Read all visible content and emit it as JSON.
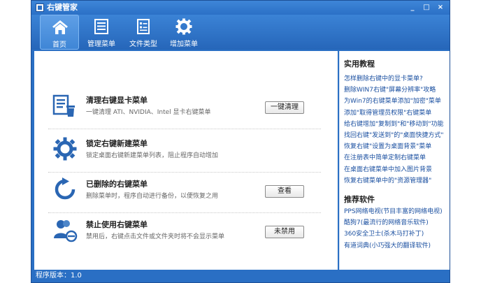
{
  "window": {
    "title": "右键管家",
    "controls": [
      "_",
      "□",
      "×"
    ]
  },
  "toolbar": {
    "items": [
      {
        "label": "首页",
        "icon": "home-icon",
        "active": true
      },
      {
        "label": "管理菜单",
        "icon": "menu-list-icon",
        "active": false
      },
      {
        "label": "文件类型",
        "icon": "file-type-icon",
        "active": false
      },
      {
        "label": "增加菜单",
        "icon": "gear-icon",
        "active": false
      }
    ]
  },
  "main": {
    "features": [
      {
        "title": "清理右键显卡菜单",
        "desc": "一键清理 ATI、NVIDIA、Intel 显卡右键菜单",
        "button": "一键清理",
        "icon": "cleanup-icon"
      },
      {
        "title": "锁定右键新建菜单",
        "desc": "锁定桌面右键新建菜单列表，阻止程序自动增加",
        "button": "",
        "icon": "gear-icon"
      },
      {
        "title": "已删除的右键菜单",
        "desc": "删除菜单时，程序自动进行备份，以便恢复之用",
        "button": "查看",
        "icon": "refresh-icon"
      },
      {
        "title": "禁止使用右键菜单",
        "desc": "禁用后，右键点击文件或文件夹时将不会显示菜单",
        "button": "未禁用",
        "icon": "user-disable-icon"
      }
    ]
  },
  "sidebar": {
    "tutorials_title": "实用教程",
    "tutorials": [
      "怎样删除右键中的显卡菜单?",
      "删除WIN7右键\"屏幕分辨率\"攻略",
      "为Win7的右键菜单添加\"加密\"菜单",
      "添加\"取得管理员权限\"右键菜单",
      "给右键增加\"复制到\"和\"移动到\"功能",
      "找回右键\"发送到\"的\"桌面快捷方式\"",
      "恢复右键\"设置为桌面背景\"菜单",
      "在注册表中简单定制右键菜单",
      "在桌面右键菜单中加入图片背景",
      "恢复右键菜单中的\"资源管理器\""
    ],
    "software_title": "推荐软件",
    "software": [
      "PPS网络电视(节目丰富的网络电视)",
      "酷狗7(最流行的网络音乐软件)",
      "360安全卫士(杀木马打补丁)",
      "有道词典(小巧强大的翻译软件)"
    ]
  },
  "status": {
    "version_label": "程序版本：1.0"
  },
  "colors": {
    "accent": "#2a6fc4",
    "link": "#1a4fa0",
    "icon_blue": "#2a66b3"
  }
}
